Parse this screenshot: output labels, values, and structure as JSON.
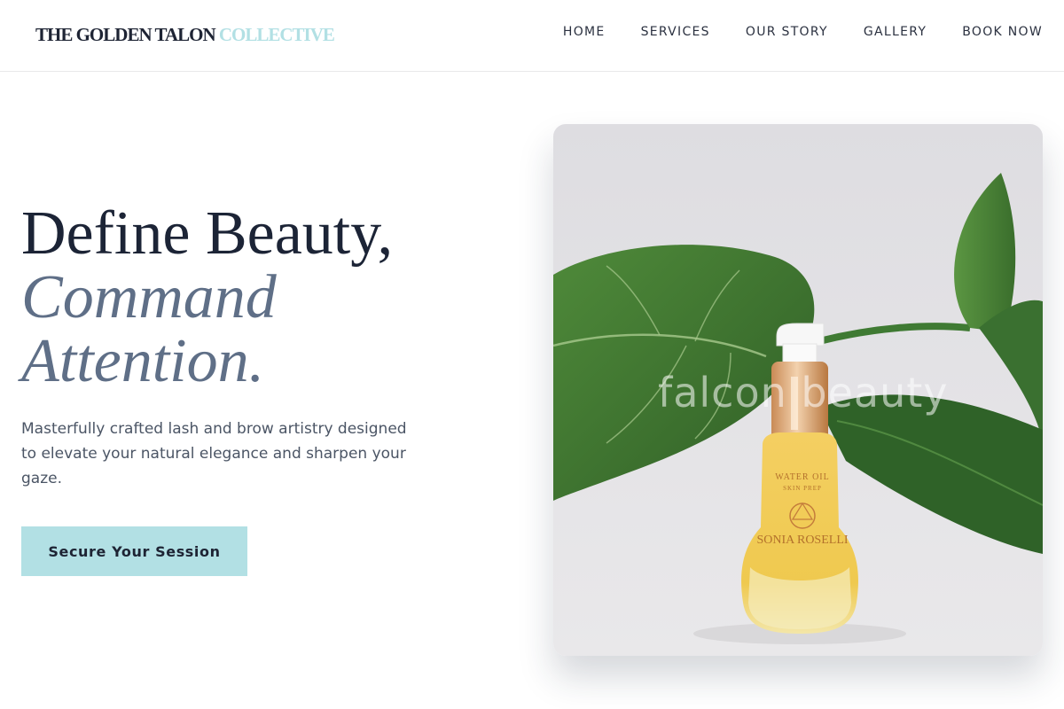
{
  "brand": {
    "name_main": "THE GOLDEN TALON",
    "name_accent": "COLLECTIVE"
  },
  "nav": {
    "items": [
      "HOME",
      "SERVICES",
      "OUR STORY",
      "GALLERY",
      "BOOK NOW"
    ]
  },
  "hero": {
    "heading_line1": "Define Beauty,",
    "heading_line2": "Command",
    "heading_line3": "Attention.",
    "subtitle": "Masterfully crafted lash and brow artistry designed to elevate your natural elegance and sharpen your gaze.",
    "cta_label": "Secure Your Session"
  },
  "image": {
    "watermark": "falcon beauty",
    "bottle_label_line1": "WATER OIL",
    "bottle_label_line2": "SKIN PREP",
    "bottle_brand": "SONIA ROSELLI"
  },
  "colors": {
    "accent": "#b2e0e4",
    "heading": "#1c2436",
    "heading_italic": "#5f6f87",
    "body_text": "#4b5565"
  }
}
